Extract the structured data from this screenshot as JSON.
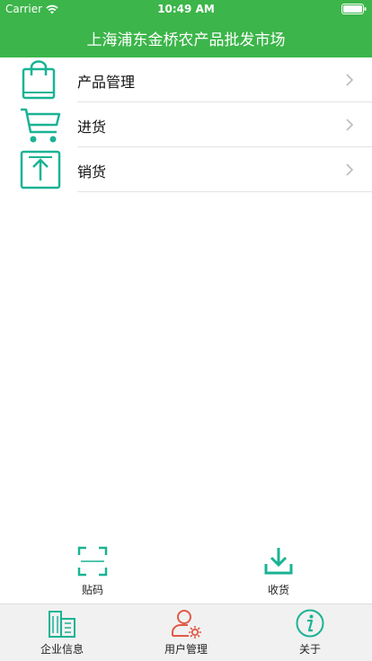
{
  "status_bar": {
    "carrier": "Carrier",
    "time": "10:49 AM"
  },
  "nav": {
    "title": "上海浦东金桥农产品批发市场"
  },
  "menu": [
    {
      "label": "产品管理",
      "icon": "shopping-bag-icon"
    },
    {
      "label": "进货",
      "icon": "shopping-cart-icon"
    },
    {
      "label": "销货",
      "icon": "upload-icon"
    }
  ],
  "quick_actions": [
    {
      "label": "贴码",
      "icon": "scan-frame-icon"
    },
    {
      "label": "收货",
      "icon": "download-tray-icon"
    }
  ],
  "tabs": [
    {
      "label": "企业信息",
      "icon": "buildings-icon"
    },
    {
      "label": "用户管理",
      "icon": "user-settings-icon"
    },
    {
      "label": "关于",
      "icon": "info-icon"
    }
  ],
  "colors": {
    "brand_green": "#3cb54a",
    "icon_teal": "#1ab394",
    "user_red": "#e05a47"
  }
}
